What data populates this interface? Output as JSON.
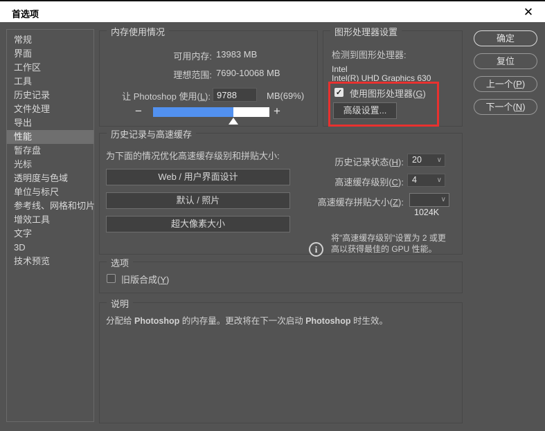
{
  "window": {
    "title": "首选项",
    "close_glyph": "✕"
  },
  "sidebar": {
    "items": [
      "常规",
      "界面",
      "工作区",
      "工具",
      "历史记录",
      "文件处理",
      "导出",
      "性能",
      "暂存盘",
      "光标",
      "透明度与色域",
      "单位与标尺",
      "参考线、网格和切片",
      "增效工具",
      "文字",
      "3D",
      "技术预览"
    ],
    "selected": "性能"
  },
  "actions": {
    "ok": "确定",
    "reset": "复位",
    "prev": {
      "pre": "上一个(",
      "key": "P",
      "post": ")"
    },
    "next": {
      "pre": "下一个(",
      "key": "N",
      "post": ")"
    }
  },
  "memory": {
    "title": "内存使用情况",
    "available_label": "可用内存:",
    "available_value": "13983 MB",
    "ideal_label": "理想范围:",
    "ideal_value": "7690-10068 MB",
    "usage_label": {
      "pre": "让 Photoshop 使用(",
      "key": "L",
      "post": "):"
    },
    "usage_value": "9788",
    "usage_suffix": "MB(69%)",
    "slider": {
      "minus": "−",
      "plus": "+",
      "fill_percent": 69,
      "fill_style": "width:69%",
      "fill_color": "#5291f0"
    }
  },
  "gpu": {
    "title": "图形处理器设置",
    "detected_label": "检测到图形处理器:",
    "vendor": "Intel",
    "model": "Intel(R) UHD Graphics 630",
    "use_gpu": {
      "pre": "使用图形处理器(",
      "key": "G",
      "post": ")",
      "checked": true,
      "check_glyph": "✓"
    },
    "advanced_button": "高级设置...",
    "highlight_color": "#e8312f"
  },
  "history": {
    "title": "历史记录与高速缓存",
    "subtitle": "为下面的情况优化高速缓存级别和拼贴大小:",
    "presets": [
      "Web / 用户界面设计",
      "默认 / 照片",
      "超大像素大小"
    ],
    "fields": [
      {
        "pre": "历史记录状态(",
        "key": "H",
        "post": "):",
        "value": "20"
      },
      {
        "pre": "高速缓存级别(",
        "key": "C",
        "post": "):",
        "value": "4"
      },
      {
        "pre": "高速缓存拼贴大小(",
        "key": "Z",
        "post": "):",
        "value": "1024K"
      }
    ],
    "chevron": "∨",
    "info_glyph": "i",
    "note_line1": "将\"高速缓存级别\"设置为 2 或更",
    "note_line2": "高以获得最佳的 GPU 性能。"
  },
  "options": {
    "title": "选项",
    "legacy": {
      "pre": "旧版合成(",
      "key": "Y",
      "post": ")",
      "checked": false
    }
  },
  "description": {
    "title": "说明",
    "parts": [
      "分配给 ",
      "Photoshop",
      " 的内存量。更改将在下一次启动 ",
      "Photoshop",
      " 时生效。"
    ]
  }
}
